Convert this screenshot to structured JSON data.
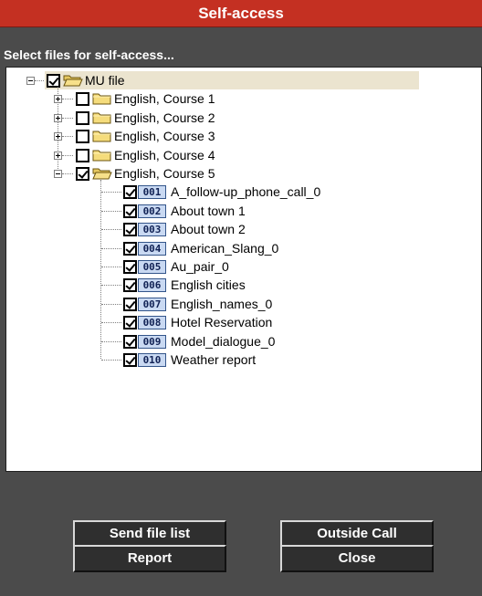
{
  "window": {
    "title": "Self-access",
    "subtitle": "Select files for self-access..."
  },
  "colors": {
    "title_bar": "#c43022",
    "panel_bg": "#4b4b4b",
    "root_highlight": "#ebe4cf",
    "badge_bg": "#c9d9f2",
    "button_bg": "#2f2f2f"
  },
  "tree": {
    "root": {
      "label": "MU file",
      "checked": true,
      "expanded": true,
      "icon": "folder-open-icon"
    },
    "courses": [
      {
        "label": "English, Course 1",
        "checked": false,
        "expanded": false
      },
      {
        "label": "English, Course 2",
        "checked": false,
        "expanded": false
      },
      {
        "label": "English, Course 3",
        "checked": false,
        "expanded": false
      },
      {
        "label": "English, Course 4",
        "checked": false,
        "expanded": false
      },
      {
        "label": "English, Course 5",
        "checked": true,
        "expanded": true
      }
    ],
    "files": [
      {
        "num": "001",
        "label": "A_follow-up_phone_call_0",
        "checked": true
      },
      {
        "num": "002",
        "label": "About town 1",
        "checked": true
      },
      {
        "num": "003",
        "label": "About town 2",
        "checked": true
      },
      {
        "num": "004",
        "label": "American_Slang_0",
        "checked": true
      },
      {
        "num": "005",
        "label": "Au_pair_0",
        "checked": true
      },
      {
        "num": "006",
        "label": "English cities",
        "checked": true
      },
      {
        "num": "007",
        "label": "English_names_0",
        "checked": true
      },
      {
        "num": "008",
        "label": "Hotel Reservation",
        "checked": true
      },
      {
        "num": "009",
        "label": "Model_dialogue_0",
        "checked": true
      },
      {
        "num": "010",
        "label": "Weather report",
        "checked": true
      }
    ]
  },
  "buttons": {
    "send_file_list": "Send file list",
    "outside_call": "Outside Call",
    "report": "Report",
    "close": "Close"
  }
}
